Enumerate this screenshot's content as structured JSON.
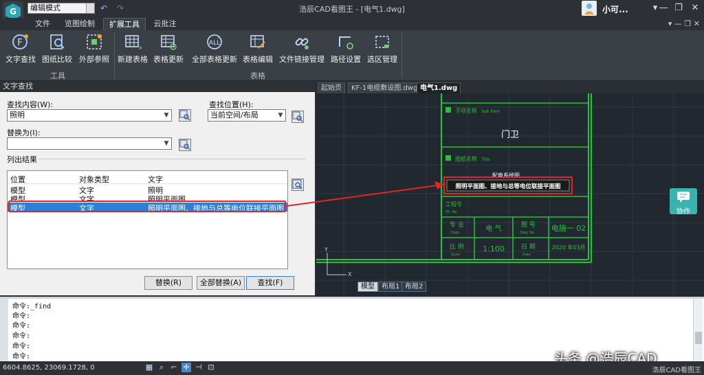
{
  "titlebar": {
    "mode": "编辑模式",
    "title": "浩辰CAD看图王 - [电气1.dwg]",
    "user": "小可...",
    "undo_icon": "undo-icon",
    "redo_icon": "redo-icon"
  },
  "ribbon_tabs": [
    "文件",
    "览图绘制",
    "扩展工具",
    "云批注"
  ],
  "ribbon_active_tab": "扩展工具",
  "ribbon": {
    "buttons": [
      "文字查找",
      "图纸比较",
      "外部参照",
      "新建表格",
      "表格更新",
      "全部表格更新",
      "表格编辑",
      "文件链接管理",
      "路径设置",
      "选区管理"
    ],
    "groups": [
      "工具",
      "表格"
    ]
  },
  "panel": {
    "title": "文字查找",
    "find_label": "查找内容(W):",
    "find_value": "照明",
    "location_label": "查找位置(H):",
    "location_value": "当前空间/布局",
    "replace_label": "替换为(I):",
    "replace_value": "",
    "results_label": "列出结果",
    "columns": [
      "位置",
      "对象类型",
      "文字"
    ],
    "rows": [
      {
        "loc": "模型",
        "type": "文字",
        "text": "照明"
      },
      {
        "loc": "模型",
        "type": "文字",
        "text": "照明平面图"
      },
      {
        "loc": "模型",
        "type": "文字",
        "text": "照明平面图、接地与总等电位联接平面图"
      }
    ],
    "buttons": {
      "replace": "替换(R)",
      "replace_all": "全部替换(A)",
      "find": "查找(F)"
    }
  },
  "doc_tabs": [
    "起始页",
    "KF-1电缆敷设图.dwg",
    "电气1.dwg"
  ],
  "layout_tabs": [
    "模型",
    "布局1",
    "布局2"
  ],
  "drawing": {
    "sub_item_label": "子项名称",
    "sub_item_en": "Sub Item",
    "sub_item_value": "门卫",
    "title_label": "图纸名称",
    "title_en": "Title",
    "title_line1": "配电系统图",
    "title_line2": "照明平面图、接地与总等电位联接平面图",
    "proj_label": "工程号",
    "proj_en": "Pjt. No.",
    "dept_label": "专 业",
    "dept_en": "Dept.",
    "dept_value": "电 气",
    "dwg_label": "图 号",
    "dwg_en": "Dwg. No.",
    "dwg_value": "电施一 02",
    "scale_label": "比 例",
    "scale_en": "Scale",
    "scale_value": "1:100",
    "date_label": "日 期",
    "date_en": "Date",
    "date_value": "2020 年03月",
    "axis_x": "X",
    "axis_y": "Y"
  },
  "collab": "协作",
  "command_lines": [
    "命令:_find",
    "命令:",
    "命令:",
    "命令:",
    "命令:",
    "命令:"
  ],
  "status": {
    "coords": "6604.8625, 23069.1728, 0",
    "app": "浩辰CAD看图王"
  },
  "watermark": "头条 @浩辰CAD",
  "colors": {
    "cad_green": "#27c23a",
    "highlight_red": "#e02626",
    "selection_blue": "#2f7fd8"
  }
}
